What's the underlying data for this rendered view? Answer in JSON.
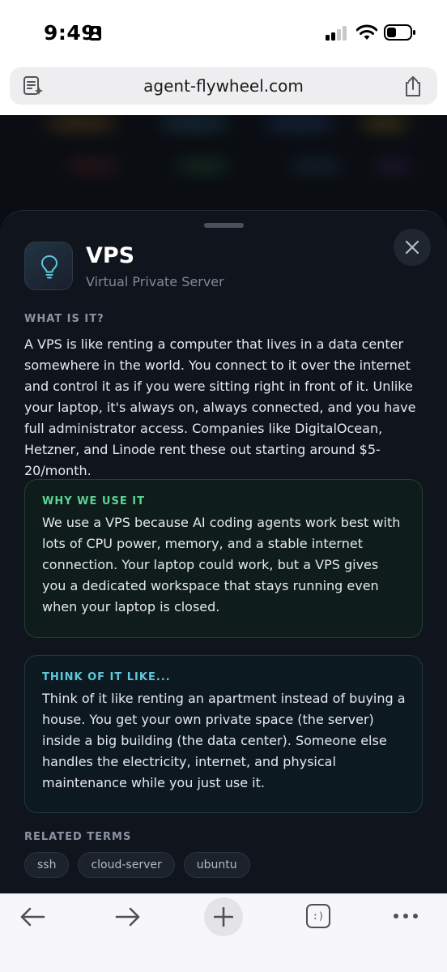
{
  "status_bar": {
    "time": "9:49"
  },
  "browser": {
    "url": "agent-flywheel.com"
  },
  "term": {
    "icon": "lightbulb-icon",
    "title": "VPS",
    "subtitle": "Virtual Private Server"
  },
  "what_is_it": {
    "label": "WHAT IS IT?",
    "body": "A VPS is like renting a computer that lives in a data center somewhere in the world. You connect to it over the internet and control it as if you were sitting right in front of it. Unlike your laptop, it's always on, always connected, and you have full administrator access. Companies like DigitalOcean, Hetzner, and Linode rent these out starting around $5-20/month."
  },
  "why_we_use_it": {
    "label": "WHY WE USE IT",
    "body": "We use a VPS because AI coding agents work best with lots of CPU power, memory, and a stable internet connection. Your laptop could work, but a VPS gives you a dedicated workspace that stays running even when your laptop is closed."
  },
  "think_of_it_like": {
    "label": "THINK OF IT LIKE...",
    "body": "Think of it like renting an apartment instead of buying a house. You get your own private space (the server) inside a big building (the data center). Someone else handles the electricity, internet, and physical maintenance while you just use it."
  },
  "related_terms": {
    "label": "RELATED TERMS",
    "tags": [
      "ssh",
      "cloud-server",
      "ubuntu"
    ]
  },
  "toolbar": {
    "tabs_glyph": ":)"
  },
  "colors": {
    "sheet_background": "#10151d",
    "why_accent": "#5bd496",
    "think_accent": "#5ec8dc"
  }
}
